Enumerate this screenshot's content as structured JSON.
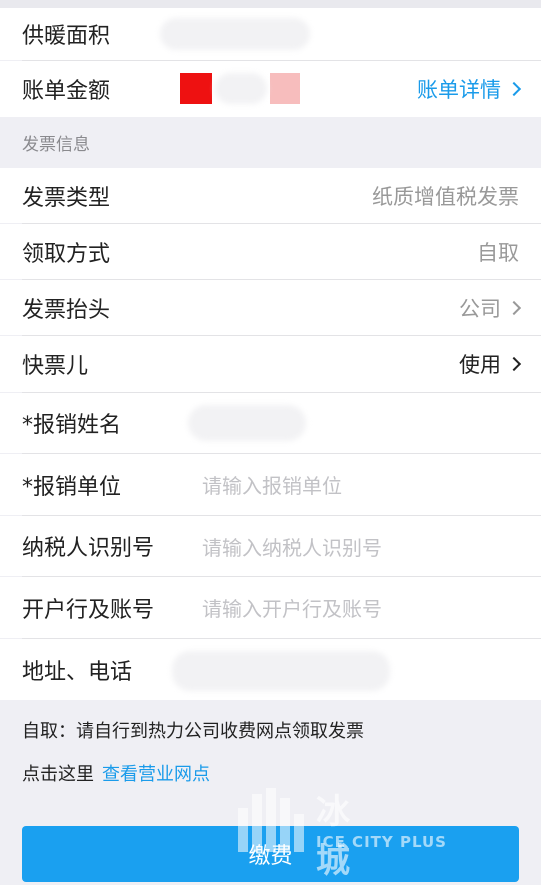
{
  "bill": {
    "heating_area_label": "供暖面积",
    "amount_label": "账单金额",
    "detail_link": "账单详情"
  },
  "invoice": {
    "section_title": "发票信息",
    "type_label": "发票类型",
    "type_value": "纸质增值税发票",
    "pickup_label": "领取方式",
    "pickup_value": "自取",
    "header_label": "发票抬头",
    "header_value": "公司",
    "quick_label": "快票儿",
    "quick_value": "使用",
    "name_label": "*报销姓名",
    "unit_label": "*报销单位",
    "unit_placeholder": "请输入报销单位",
    "taxid_label": "纳税人识别号",
    "taxid_placeholder": "请输入纳税人识别号",
    "bank_label": "开户行及账号",
    "bank_placeholder": "请输入开户行及账号",
    "address_label": "地址、电话"
  },
  "notes": {
    "pickup_note": "自取：请自行到热力公司收费网点领取发票",
    "click_here": "点击这里",
    "view_outlets_link": "查看营业网点"
  },
  "pay_button": "缴费",
  "watermark": {
    "cn": "冰城+",
    "en": "ICE CITY PLUS"
  },
  "colors": {
    "accent": "#1a9bea",
    "button": "#1aa0f0",
    "background": "#efeff4"
  }
}
